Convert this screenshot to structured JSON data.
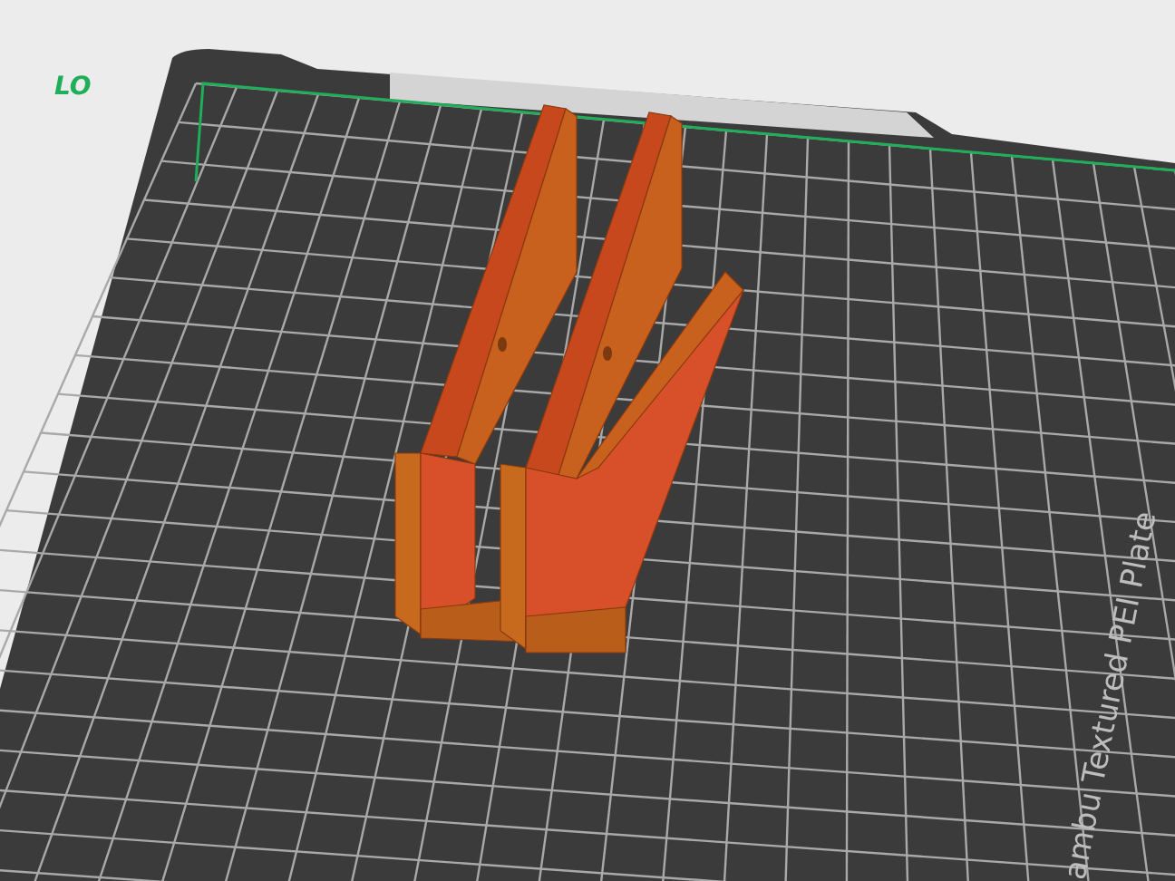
{
  "viewport": {
    "plate_label": "LO",
    "plate_name": "ambu Textured PEI Plate"
  }
}
